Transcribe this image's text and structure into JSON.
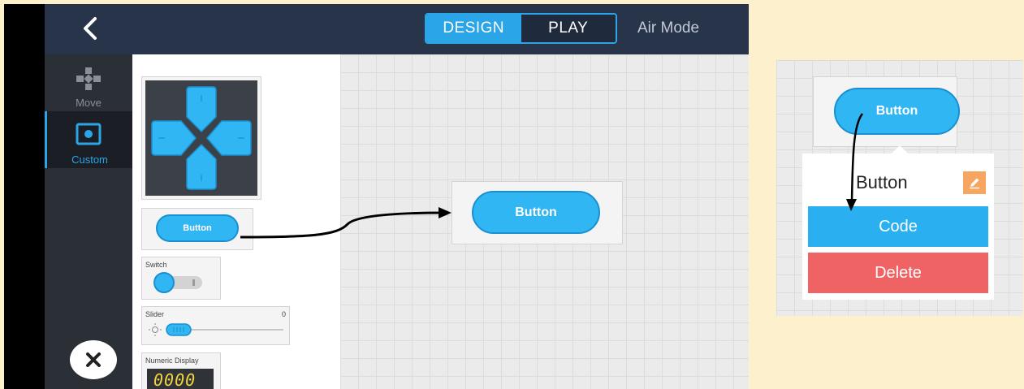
{
  "app": {
    "back_icon": "chevron-left-icon",
    "tabs": [
      {
        "label": "DESIGN",
        "active": true
      },
      {
        "label": "PLAY",
        "active": false
      }
    ],
    "mode_label": "Air Mode",
    "sidebar": {
      "items": [
        {
          "label": "Move",
          "icon": "gamepad-icon",
          "active": false
        },
        {
          "label": "Custom",
          "icon": "custom-widget-icon",
          "active": true
        }
      ]
    },
    "palette": {
      "button_label": "Button",
      "switch_title": "Switch",
      "slider_title": "Slider",
      "slider_value": "0",
      "numeric_title": "Numeric Display",
      "numeric_value": "0000"
    },
    "canvas": {
      "button_label": "Button"
    },
    "close_icon": "close-icon"
  },
  "detail": {
    "button_label": "Button",
    "popover": {
      "title": "Button",
      "edit_icon": "pencil-icon",
      "code_label": "Code",
      "delete_label": "Delete"
    }
  },
  "colors": {
    "accent": "#2aa6e8",
    "header": "#27344a",
    "sidebar": "#2b2f36",
    "delete": "#f06364",
    "edit": "#f6a660",
    "background": "#fdf1cd"
  }
}
